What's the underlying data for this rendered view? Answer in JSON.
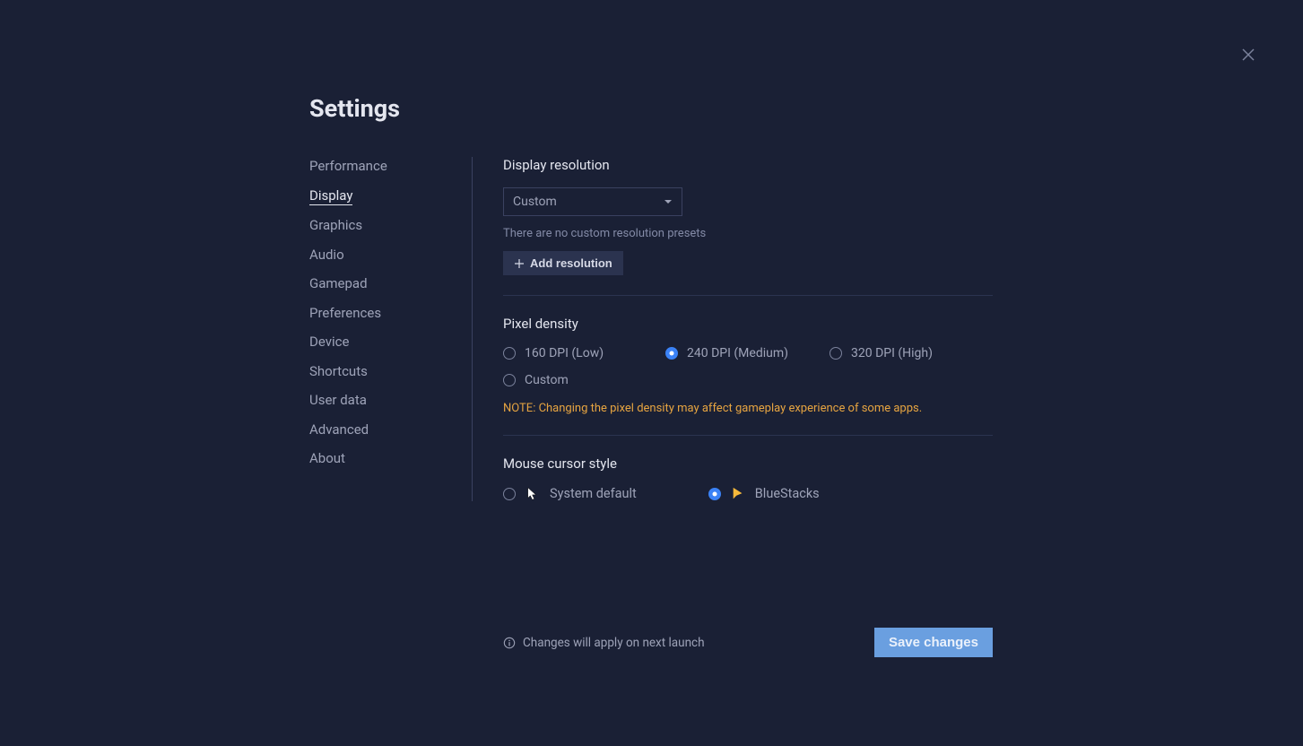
{
  "title": "Settings",
  "sidebar": {
    "items": [
      {
        "label": "Performance"
      },
      {
        "label": "Display"
      },
      {
        "label": "Graphics"
      },
      {
        "label": "Audio"
      },
      {
        "label": "Gamepad"
      },
      {
        "label": "Preferences"
      },
      {
        "label": "Device"
      },
      {
        "label": "Shortcuts"
      },
      {
        "label": "User data"
      },
      {
        "label": "Advanced"
      },
      {
        "label": "About"
      }
    ],
    "active_index": 1
  },
  "display_resolution": {
    "heading": "Display resolution",
    "select_value": "Custom",
    "no_presets_text": "There are no custom resolution presets",
    "add_button": "Add resolution"
  },
  "pixel_density": {
    "heading": "Pixel density",
    "options": [
      {
        "label": "160 DPI (Low)",
        "checked": false
      },
      {
        "label": "240 DPI (Medium)",
        "checked": true
      },
      {
        "label": "320 DPI (High)",
        "checked": false
      },
      {
        "label": "Custom",
        "checked": false
      }
    ],
    "note": "NOTE: Changing the pixel density may affect gameplay experience of some apps."
  },
  "mouse_cursor": {
    "heading": "Mouse cursor style",
    "options": [
      {
        "label": "System default",
        "checked": false
      },
      {
        "label": "BlueStacks",
        "checked": true
      }
    ]
  },
  "footer": {
    "notice": "Changes will apply on next launch",
    "save_button": "Save changes"
  }
}
